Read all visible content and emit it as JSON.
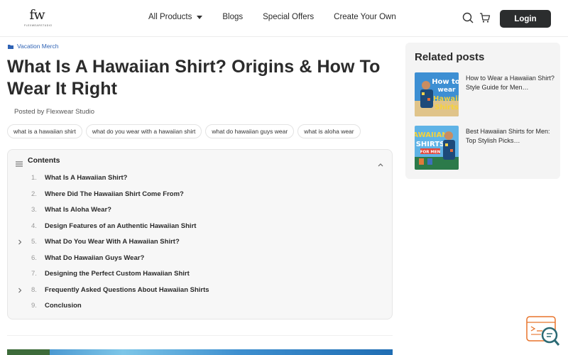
{
  "header": {
    "logo_text": "FW",
    "logo_subtext": "FLEXWEARSTUDIO",
    "nav": [
      {
        "label": "All Products",
        "has_dropdown": true
      },
      {
        "label": "Blogs"
      },
      {
        "label": "Special Offers"
      },
      {
        "label": "Create Your Own"
      }
    ],
    "icons": [
      "search-icon",
      "cart-icon"
    ],
    "login_label": "Login"
  },
  "article": {
    "category": "Vacation Merch",
    "title": "What Is A Hawaiian Shirt? Origins & How To Wear It Right",
    "author": "Posted by Flexwear Studio",
    "tags": [
      "what is a hawaiian shirt",
      "what do you wear with a hawaiian shirt",
      "what do hawaiian guys wear",
      "what is aloha wear"
    ]
  },
  "toc": {
    "title": "Contents",
    "items": [
      {
        "num": "1.",
        "label": "What Is A Hawaiian Shirt?",
        "expandable": false
      },
      {
        "num": "2.",
        "label": "Where Did The Hawaiian Shirt Come From?",
        "expandable": false
      },
      {
        "num": "3.",
        "label": "What Is Aloha Wear?",
        "expandable": false
      },
      {
        "num": "4.",
        "label": "Design Features of an Authentic Hawaiian Shirt",
        "expandable": false
      },
      {
        "num": "5.",
        "label": "What Do You Wear With A Hawaiian Shirt?",
        "expandable": true
      },
      {
        "num": "6.",
        "label": "What Do Hawaiian Guys Wear?",
        "expandable": false
      },
      {
        "num": "7.",
        "label": "Designing the Perfect Custom Hawaiian Shirt",
        "expandable": false
      },
      {
        "num": "8.",
        "label": "Frequently Asked Questions About Hawaiian Shirts",
        "expandable": true
      },
      {
        "num": "9.",
        "label": "Conclusion",
        "expandable": false
      }
    ]
  },
  "sidebar": {
    "title": "Related posts",
    "posts": [
      {
        "title": "How to Wear a Hawaiian Shirt? Style Guide for Men…",
        "thumb_text": [
          "How to",
          "wear",
          "Hawaii",
          "Shirts"
        ]
      },
      {
        "title": "Best Hawaiian Shirts for Men: Top Stylish Picks…",
        "thumb_text": [
          "AWAIIAN",
          "SHIRTS",
          "FOR MEN"
        ]
      }
    ]
  },
  "colors": {
    "accent_link": "#2f63b5",
    "login_bg": "#2b2d2e",
    "float_accent": "#e8742b"
  }
}
